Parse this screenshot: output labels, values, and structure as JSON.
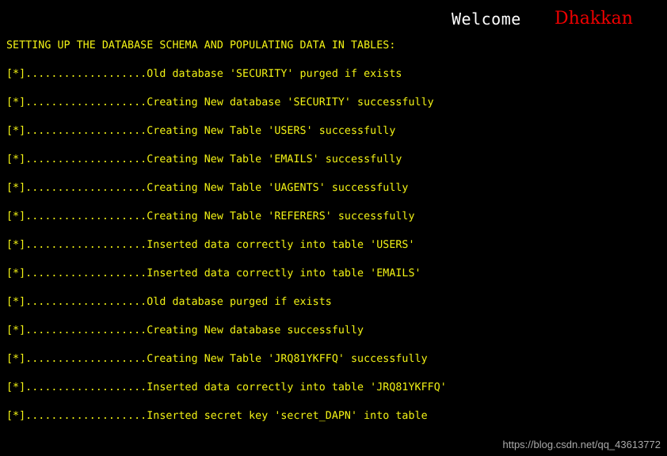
{
  "window": {
    "title": "SETTING UP THE DATABASE SCHEMA AND POPULATING DATA IN TABLES:",
    "background_color": "#000000"
  },
  "header": {
    "welcome_label": "Welcome",
    "brand_label": "Dhakkan",
    "welcome_color": "#ffffff",
    "brand_color": "#ee0000"
  },
  "terminal": {
    "text_color": "#f3f315",
    "prefix": "[*]...................",
    "heading": "SETTING UP THE DATABASE SCHEMA AND POPULATING DATA IN TABLES:",
    "lines": [
      {
        "index": 0,
        "prefix": "[*]...................",
        "message": "Old database 'SECURITY' purged if exists"
      },
      {
        "index": 1,
        "prefix": "[*]...................",
        "message": "Creating New database 'SECURITY' successfully"
      },
      {
        "index": 2,
        "prefix": "[*]...................",
        "message": "Creating New Table 'USERS' successfully"
      },
      {
        "index": 3,
        "prefix": "[*]...................",
        "message": "Creating New Table 'EMAILS' successfully"
      },
      {
        "index": 4,
        "prefix": "[*]...................",
        "message": "Creating New Table 'UAGENTS' successfully"
      },
      {
        "index": 5,
        "prefix": "[*]...................",
        "message": "Creating New Table 'REFERERS' successfully"
      },
      {
        "index": 6,
        "prefix": "[*]...................",
        "message": "Inserted data correctly into table 'USERS'"
      },
      {
        "index": 7,
        "prefix": "[*]...................",
        "message": "Inserted data correctly into table 'EMAILS'"
      },
      {
        "index": 8,
        "prefix": "[*]...................",
        "message": "Old database purged if exists"
      },
      {
        "index": 9,
        "prefix": "[*]...................",
        "message": "Creating New database successfully"
      },
      {
        "index": 10,
        "prefix": "[*]...................",
        "message": "Creating New Table 'JRQ81YKFFQ' successfully"
      },
      {
        "index": 11,
        "prefix": "[*]...................",
        "message": "Inserted data correctly into table 'JRQ81YKFFQ'"
      },
      {
        "index": 12,
        "prefix": "[*]...................",
        "message": "Inserted secret key 'secret_DAPN' into table"
      }
    ]
  },
  "watermark": {
    "text": "https://blog.csdn.net/qq_43613772",
    "color": "#b9b9b9"
  }
}
